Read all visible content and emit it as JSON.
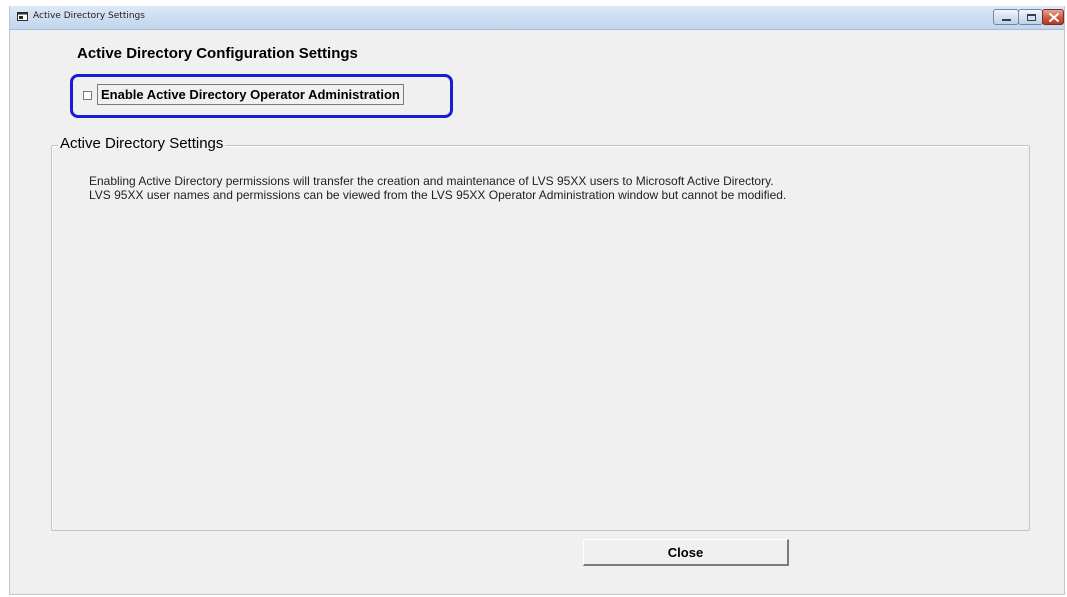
{
  "window": {
    "title": "Active Directory Settings"
  },
  "main": {
    "heading": "Active Directory Configuration Settings",
    "enable_checkbox": {
      "label": "Enable Active Directory Operator Administration",
      "checked": false
    }
  },
  "group": {
    "title": "Active Directory Settings",
    "description_line1": "Enabling Active Directory permissions will transfer the creation and maintenance of LVS 95XX users to Microsoft Active Directory.",
    "description_line2": "LVS 95XX user names and permissions can be viewed from the LVS 95XX Operator Administration window but cannot be modified."
  },
  "footer": {
    "close_label": "Close"
  },
  "colors": {
    "highlight_border": "#1c1cd6",
    "window_bg": "#f0f0f0",
    "close_caption": "#c2452b"
  }
}
